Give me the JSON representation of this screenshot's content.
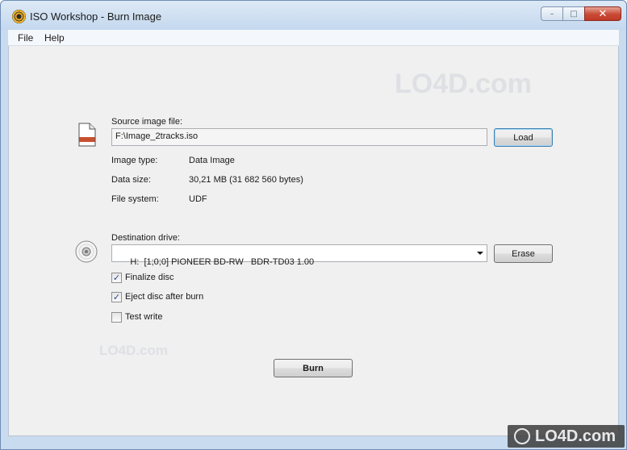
{
  "window": {
    "title": "ISO Workshop - Burn Image",
    "controls": {
      "minimize": "–",
      "maximize": "□",
      "close": "✕"
    }
  },
  "menu": {
    "file": "File",
    "help": "Help"
  },
  "source": {
    "label": "Source image file:",
    "path": "F:\\Image_2tracks.iso",
    "load_button": "Load",
    "icon": "file-icon",
    "details": [
      {
        "key": "Image type:",
        "value": "Data Image"
      },
      {
        "key": "Data size:",
        "value": "30,21 MB (31 682 560 bytes)"
      },
      {
        "key": "File system:",
        "value": "UDF"
      }
    ]
  },
  "destination": {
    "label": "Destination drive:",
    "selected_drive": "H:  [1;0;0] PIONEER BD-RW   BDR-TD03 1.00",
    "erase_button": "Erase",
    "icon": "disc-icon"
  },
  "options": [
    {
      "label": "Finalize disc",
      "checked": true
    },
    {
      "label": "Eject disc after burn",
      "checked": true
    },
    {
      "label": "Test write",
      "checked": false
    }
  ],
  "burn_button": "Burn",
  "watermark": {
    "text": "LO4D.com"
  },
  "colors": {
    "title_bar": "#c4d8ee",
    "close_button": "#c94a36",
    "client_bg": "#f0f0f0",
    "file_icon_stripe": "#c8502e"
  }
}
